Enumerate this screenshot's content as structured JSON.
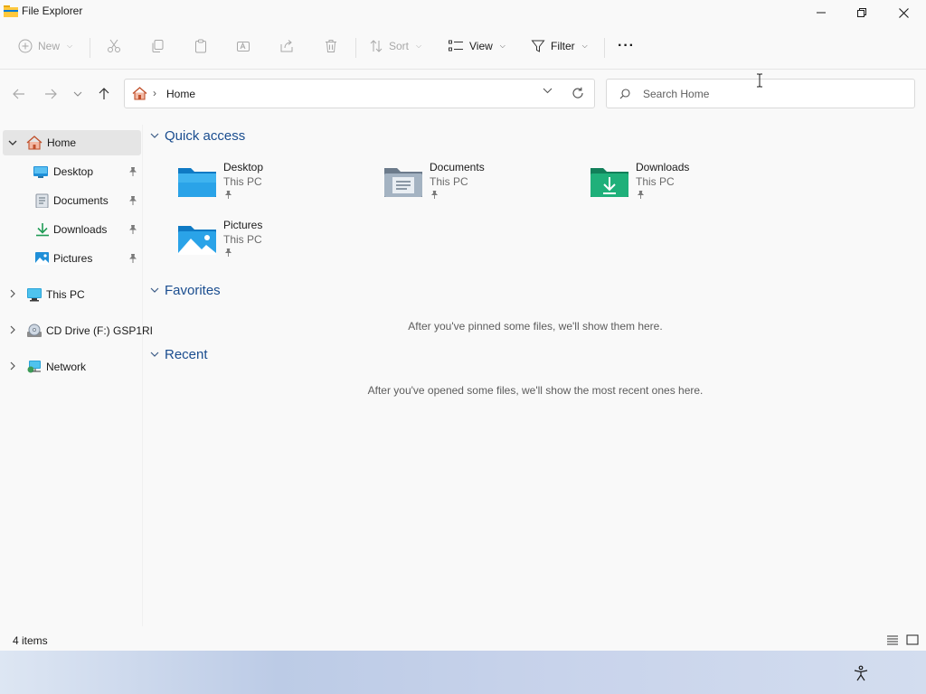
{
  "window": {
    "title": "File Explorer"
  },
  "commandbar": {
    "new_label": "New",
    "sort_label": "Sort",
    "view_label": "View",
    "filter_label": "Filter",
    "more_label": "···"
  },
  "addressbar": {
    "path_label": "Home",
    "separator": "›"
  },
  "search": {
    "placeholder": "Search Home"
  },
  "sidebar": {
    "items": [
      {
        "label": "Home"
      },
      {
        "label": "Desktop"
      },
      {
        "label": "Documents"
      },
      {
        "label": "Downloads"
      },
      {
        "label": "Pictures"
      },
      {
        "label": "This PC"
      },
      {
        "label": "CD Drive (F:) GSP1RI"
      },
      {
        "label": "Network"
      }
    ]
  },
  "main": {
    "quick_access": {
      "header": "Quick access",
      "items": [
        {
          "name": "Desktop",
          "location": "This PC"
        },
        {
          "name": "Documents",
          "location": "This PC"
        },
        {
          "name": "Downloads",
          "location": "This PC"
        },
        {
          "name": "Pictures",
          "location": "This PC"
        }
      ]
    },
    "favorites": {
      "header": "Favorites",
      "empty_message": "After you've pinned some files, we'll show them here."
    },
    "recent": {
      "header": "Recent",
      "empty_message": "After you've opened some files, we'll show the most recent ones here."
    }
  },
  "status": {
    "item_count": "4 items"
  },
  "colors": {
    "accent": "#0067c0",
    "group_header": "#1a4d8f",
    "selected_bg": "#e5e5e5"
  }
}
